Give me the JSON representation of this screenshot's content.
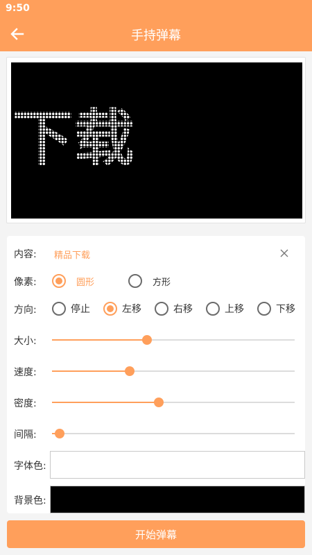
{
  "status_bar": {
    "time": "9:50"
  },
  "app_bar": {
    "title": "手持弹幕"
  },
  "preview": {
    "text": "下载",
    "pixel_color": "#ffffff",
    "background": "#000000"
  },
  "form": {
    "content": {
      "label": "内容:",
      "value": "精品下载"
    },
    "pixel": {
      "label": "像素:",
      "options": [
        "圆形",
        "方形"
      ],
      "selected": "圆形"
    },
    "direction": {
      "label": "方向:",
      "options": [
        "停止",
        "左移",
        "右移",
        "上移",
        "下移"
      ],
      "selected": "左移"
    },
    "size": {
      "label": "大小:",
      "level": 0.39
    },
    "speed": {
      "label": "速度:",
      "level": 0.32
    },
    "density": {
      "label": "密度:",
      "level": 0.44
    },
    "spacing": {
      "label": "间隔:",
      "level": 0.03
    },
    "font_color": {
      "label": "字体色:",
      "value": "#ffffff"
    },
    "bg_color": {
      "label": "背景色:",
      "value": "#000000"
    }
  },
  "start_button": {
    "label": "开始弹幕"
  },
  "colors": {
    "accent": "#ff9f5b",
    "track": "#dcdcdc"
  }
}
